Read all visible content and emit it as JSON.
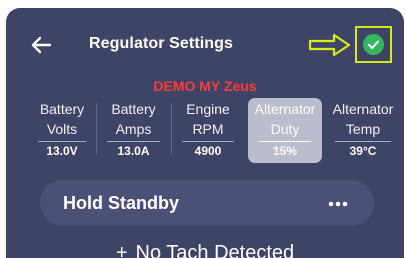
{
  "header": {
    "title": "Regulator Settings"
  },
  "demo_label": "DEMO MY Zeus",
  "metrics": [
    {
      "line1": "Battery",
      "line2": "Volts",
      "value": "13.0V"
    },
    {
      "line1": "Battery",
      "line2": "Amps",
      "value": "13.0A"
    },
    {
      "line1": "Engine",
      "line2": "RPM",
      "value": "4900"
    },
    {
      "line1": "Alternator",
      "line2": "Duty",
      "value": "15%"
    },
    {
      "line1": "Alternator",
      "line2": "Temp",
      "value": "39°C"
    }
  ],
  "standby": {
    "label": "Hold Standby"
  },
  "status": {
    "prefix": "+",
    "text": "No Tach Detected"
  },
  "colors": {
    "background": "#3e4466",
    "demo_red": "#ff3b3b",
    "accent_yellow": "#d6ec1a",
    "check_green": "#34b85e",
    "selected_tab": "#b9bdcc"
  },
  "icons": {
    "back": "arrow-left-icon",
    "pointer": "arrow-right-outline-icon",
    "confirm": "check-circle-icon",
    "more": "more-horizontal-icon"
  }
}
